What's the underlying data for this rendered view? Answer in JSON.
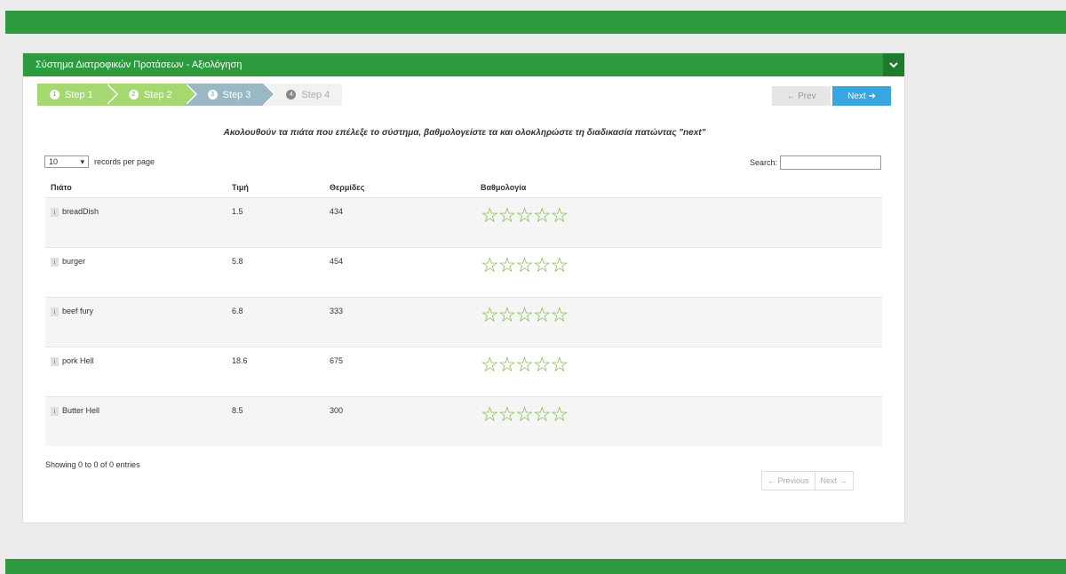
{
  "panel": {
    "title": "Σύστημα Διατροφικών Προτάσεων - Αξιολόγηση"
  },
  "wizard": {
    "steps": [
      {
        "num": "1",
        "label": "Step 1",
        "state": "done"
      },
      {
        "num": "2",
        "label": "Step 2",
        "state": "done"
      },
      {
        "num": "3",
        "label": "Step 3",
        "state": "active"
      },
      {
        "num": "4",
        "label": "Step 4",
        "state": "todo"
      }
    ],
    "prev_label": "← Prev",
    "next_label": "Next ➔"
  },
  "instruction": "Ακολουθούν τα πιάτα που επέλεξε το σύστημα, βαθμολογείστε τα και ολοκληρώστε τη διαδικασία πατώντας \"next\"",
  "table_controls": {
    "length_value": "10",
    "length_label": "records per page",
    "search_label": "Search:"
  },
  "table": {
    "headers": [
      "Πιάτο",
      "Τιμή",
      "Θερμίδες",
      "Βαθμολογία"
    ],
    "rows": [
      {
        "dish": "breadDish",
        "price": "1.5",
        "calories": "434",
        "rating": 0
      },
      {
        "dish": "burger",
        "price": "5.8",
        "calories": "454",
        "rating": 0
      },
      {
        "dish": "beef fury",
        "price": "6.8",
        "calories": "333",
        "rating": 0
      },
      {
        "dish": "pork Hell",
        "price": "18.6",
        "calories": "675",
        "rating": 0
      },
      {
        "dish": "Butter Hell",
        "price": "8.5",
        "calories": "300",
        "rating": 0
      }
    ]
  },
  "footer": {
    "showing": "Showing 0 to 0 of 0 entries",
    "previous_label": "← Previous",
    "next_label": "Next →"
  },
  "colors": {
    "brand_green": "#2e9a3f",
    "star_green": "#7cb342",
    "next_blue": "#39a6e0"
  }
}
